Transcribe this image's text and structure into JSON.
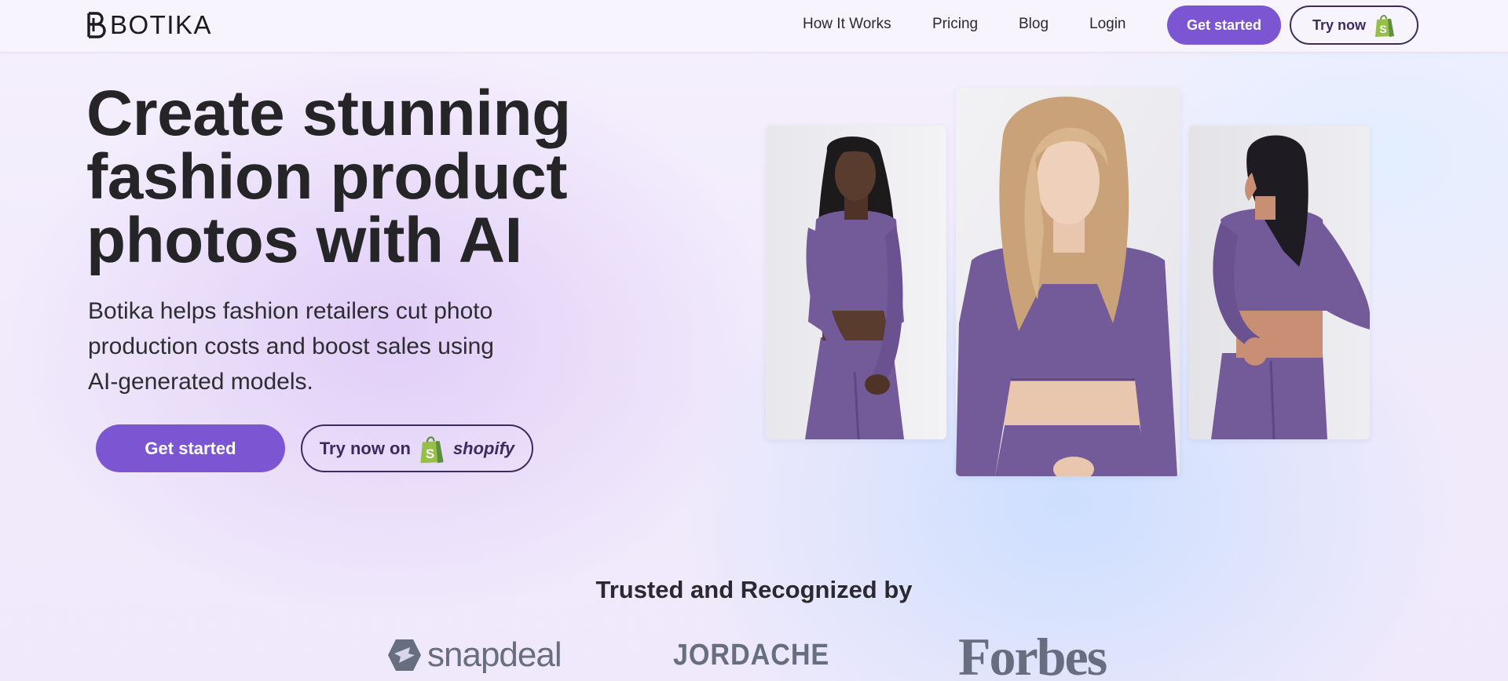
{
  "brand": {
    "name": "BOTIKA",
    "logo_icon": "botika-b-icon"
  },
  "nav": {
    "links": [
      "How It Works",
      "Pricing",
      "Blog",
      "Login"
    ],
    "get_started": "Get started",
    "try_now": "Try now",
    "try_now_icon": "shopify-bag-icon"
  },
  "hero": {
    "title": "Create stunning fashion product photos with AI",
    "subtitle": "Botika helps fashion retailers cut photo production costs and boost sales using AI-generated models.",
    "cta_primary": "Get started",
    "cta_secondary": "Try now on",
    "cta_secondary_brand": "shopify"
  },
  "photos": [
    {
      "name": "model-front-dark-hair"
    },
    {
      "name": "model-front-blonde"
    },
    {
      "name": "model-back-dark-hair"
    }
  ],
  "trusted": {
    "title": "Trusted and Recognized by",
    "logos": [
      "snapdeal",
      "JORDACHE",
      "Forbes"
    ]
  },
  "colors": {
    "accent": "#7b55d2",
    "outline": "#3d2b5e",
    "outfit": "#735b9a",
    "shopify_green": "#95bf47",
    "logo_gray": "#676e80"
  }
}
